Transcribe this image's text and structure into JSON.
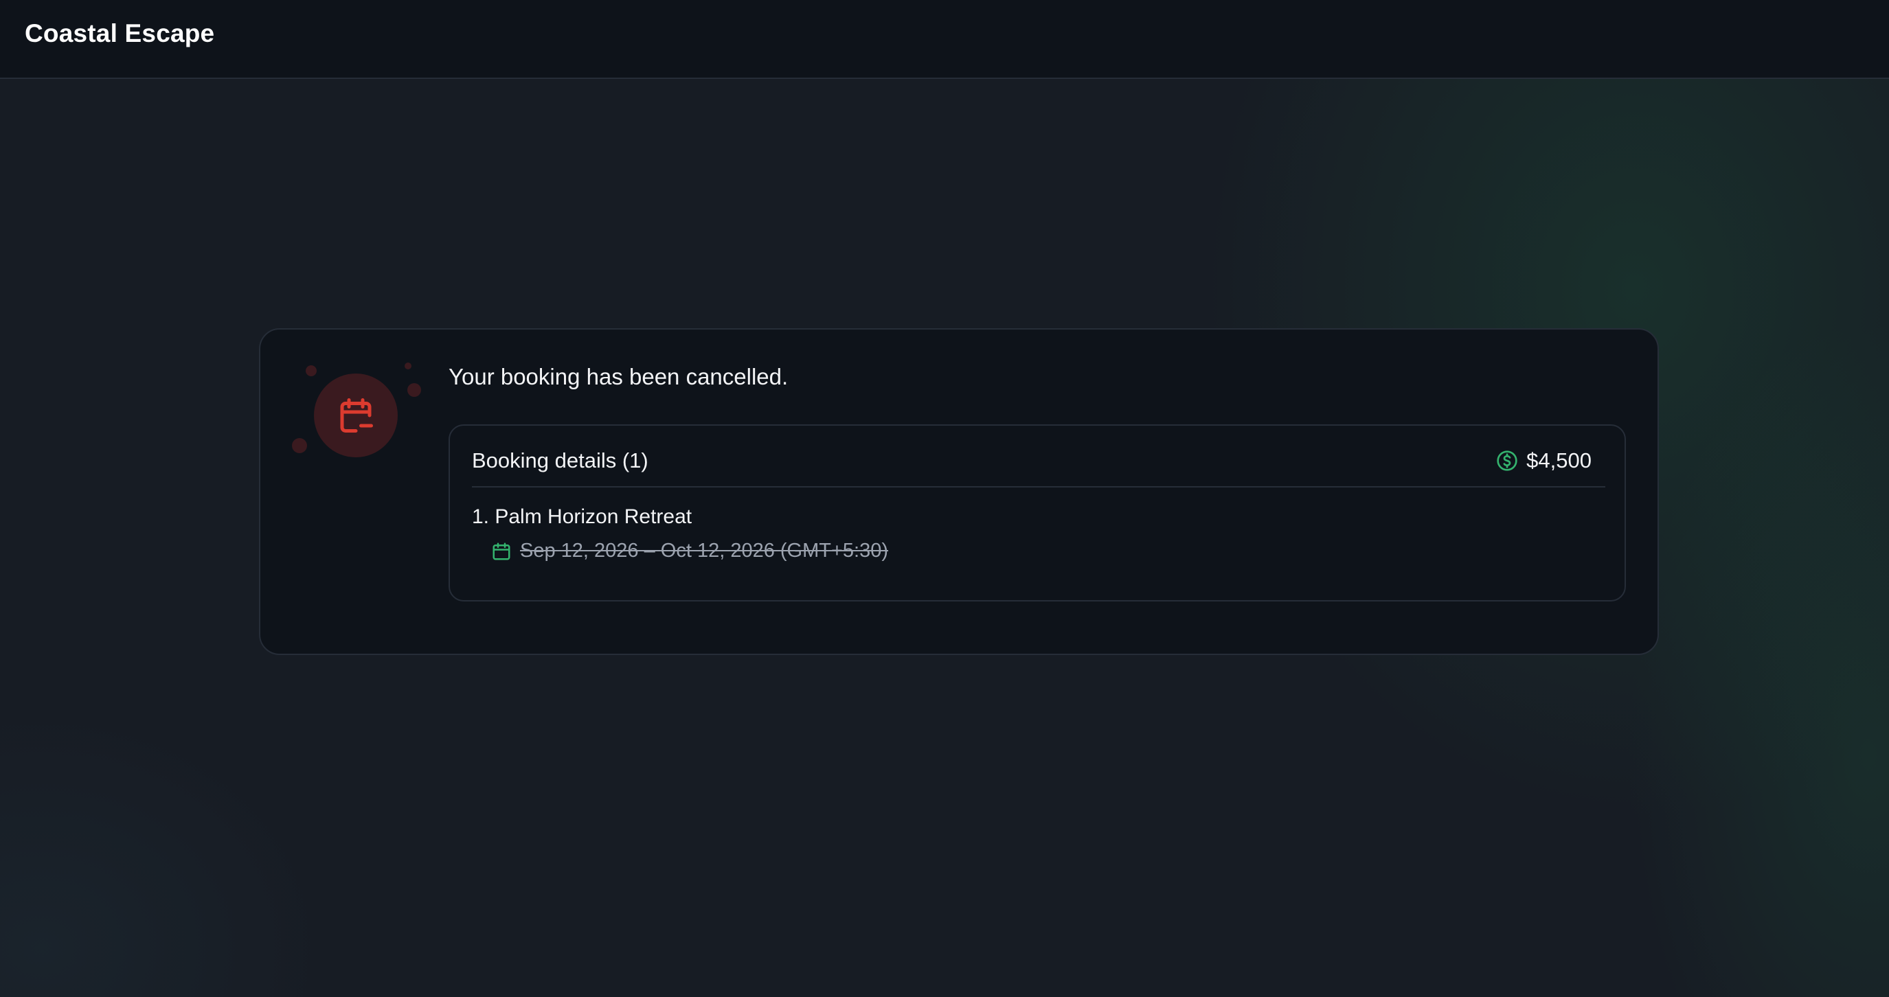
{
  "app": {
    "title": "Coastal Escape"
  },
  "status": {
    "icon": "calendar-minus-icon",
    "message": "Your booking has been cancelled."
  },
  "booking_details": {
    "title": "Booking details (1)",
    "total_icon": "dollar-circle-icon",
    "total": "$4,500",
    "items": [
      {
        "name": "1. Palm Horizon Retreat",
        "date_icon": "calendar-icon",
        "dates": "Sep 12, 2026 – Oct 12, 2026 (GMT+5:30)"
      }
    ]
  },
  "colors": {
    "background": "#171c24",
    "surface": "#0e131a",
    "border": "#262d38",
    "danger": "#dc3b2f",
    "success": "#34b36e"
  }
}
